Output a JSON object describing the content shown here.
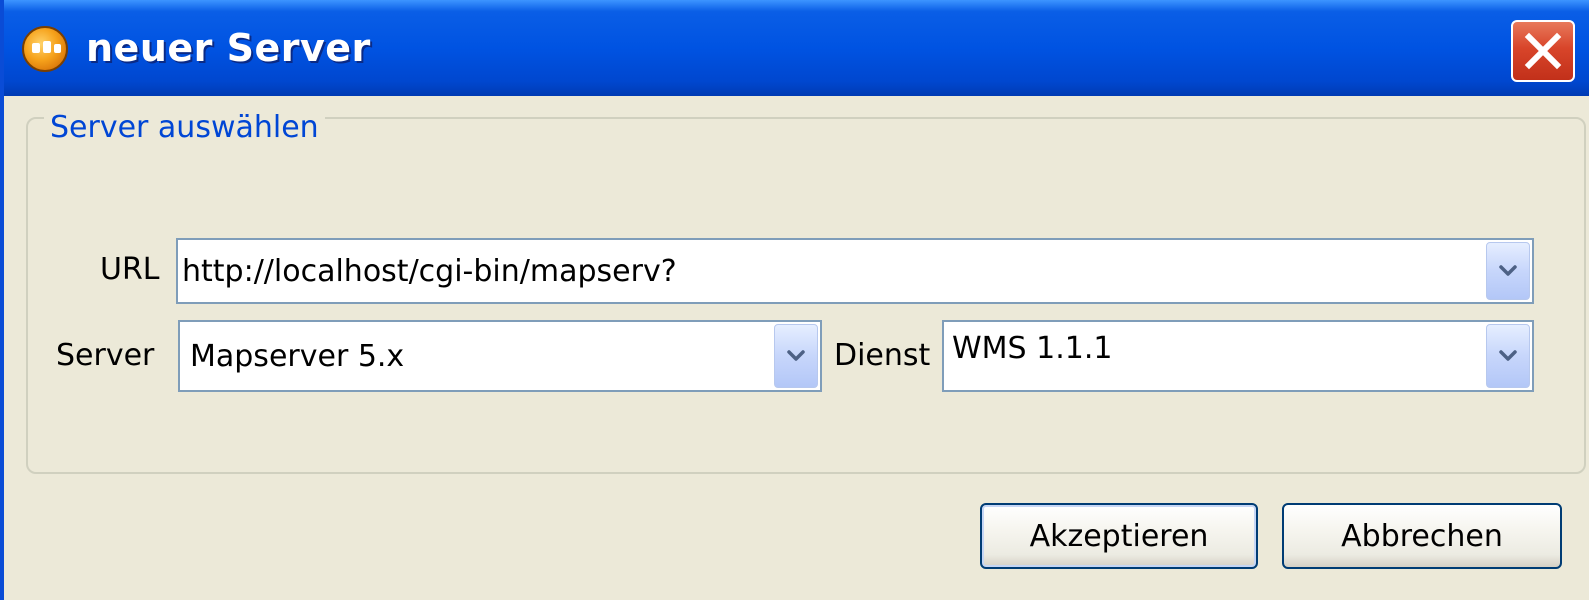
{
  "window": {
    "title": "neuer Server"
  },
  "group": {
    "title": "Server auswählen"
  },
  "form": {
    "url_label": "URL",
    "url_value": "http://localhost/cgi-bin/mapserv?",
    "server_label": "Server",
    "server_value": "Mapserver 5.x",
    "dienst_label": "Dienst",
    "dienst_value": "WMS 1.1.1"
  },
  "buttons": {
    "accept": "Akzeptieren",
    "cancel": "Abbrechen"
  },
  "icons": {
    "app": "app-globe-icon",
    "close": "close-icon",
    "dropdown": "chevron-down-icon"
  },
  "colors": {
    "titlebar": "#0053e2",
    "close": "#d8452a",
    "group_title": "#0046d5",
    "background": "#ece9d8"
  }
}
